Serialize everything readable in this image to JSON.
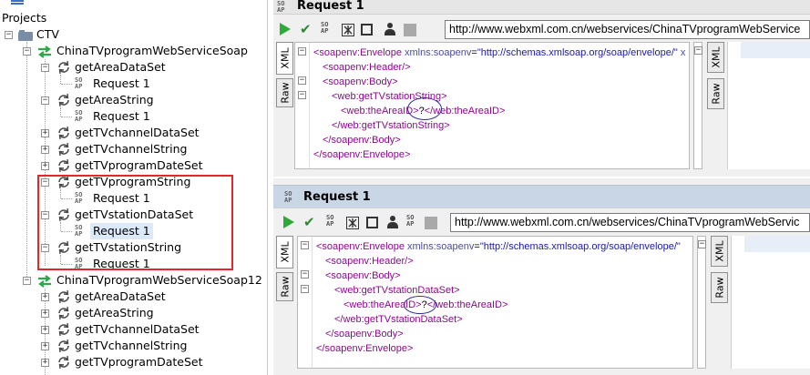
{
  "tree": {
    "root_label": "Projects",
    "project": "CTV",
    "interfaces": [
      {
        "name": "ChinaTVprogramWebServiceSoap",
        "operations": [
          {
            "name": "getAreaDataSet",
            "requests": [
              "Request 1"
            ]
          },
          {
            "name": "getAreaString",
            "requests": [
              "Request 1"
            ]
          },
          {
            "name": "getTVchannelDataSet",
            "requests": []
          },
          {
            "name": "getTVchannelString",
            "requests": []
          },
          {
            "name": "getTVprogramDateSet",
            "requests": []
          },
          {
            "name": "getTVprogramString",
            "requests": [
              "Request 1"
            ]
          },
          {
            "name": "getTVstationDataSet",
            "requests": [
              "Request 1"
            ],
            "selected": true
          },
          {
            "name": "getTVstationString",
            "requests": [
              "Request 1"
            ]
          }
        ]
      },
      {
        "name": "ChinaTVprogramWebServiceSoap12",
        "operations": [
          {
            "name": "getAreaDataSet"
          },
          {
            "name": "getAreaString"
          },
          {
            "name": "getTVchannelDataSet"
          },
          {
            "name": "getTVchannelString"
          },
          {
            "name": "getTVprogramDateSet"
          }
        ]
      }
    ],
    "highlight_color": "#e2282c"
  },
  "request1": {
    "title": "Request 1",
    "soap_badge": "SO AP",
    "url": "http://www.webxml.com.cn/webservices/ChinaTVprogramWebService",
    "tabs": {
      "xml": "XML",
      "raw": "Raw"
    },
    "code": {
      "env_open_tag": "<soapenv:Envelope",
      "env_attr": "xmlns:soapenv",
      "env_val": "\"http://schemas.xmlsoap.org/soap/envelope/\"",
      "env_tail": "x",
      "header": "<soapenv:Header/>",
      "body_open": "<soapenv:Body>",
      "op_open": "<web:getTVstationString>",
      "param_open": "<web:theAreaID>",
      "param_value": "?",
      "param_close": "</web:theAreaID>",
      "op_close": "</web:getTVstationString>",
      "body_close": "</soapenv:Body>",
      "env_close": "</soapenv:Envelope>"
    }
  },
  "request2": {
    "title": "Request 1",
    "soap_badge": "SO AP",
    "url": "http://www.webxml.com.cn/webservices/ChinaTVprogramWebServic",
    "tabs": {
      "xml": "XML",
      "raw": "Raw"
    },
    "code": {
      "env_open_tag": "<soapenv:Envelope",
      "env_attr": "xmlns:soapenv",
      "env_val": "\"http://schemas.xmlsoap.org/soap/envelope/\"",
      "header": "<soapenv:Header/>",
      "body_open": "<soapenv:Body>",
      "op_open": "<web:getTVstationDataSet>",
      "param_open": "<web:theAreaID>",
      "param_value": "?",
      "param_close": "</web:theAreaID>",
      "op_close": "</web:getTVstationDataSet>",
      "body_close": "</soapenv:Body>",
      "env_close": "</soapenv:Envelope>"
    }
  },
  "colors": {
    "play": "#2eaa3a",
    "tag": "#8a0a8a",
    "value": "#1a1aa8",
    "selection": "#dce9fa"
  }
}
